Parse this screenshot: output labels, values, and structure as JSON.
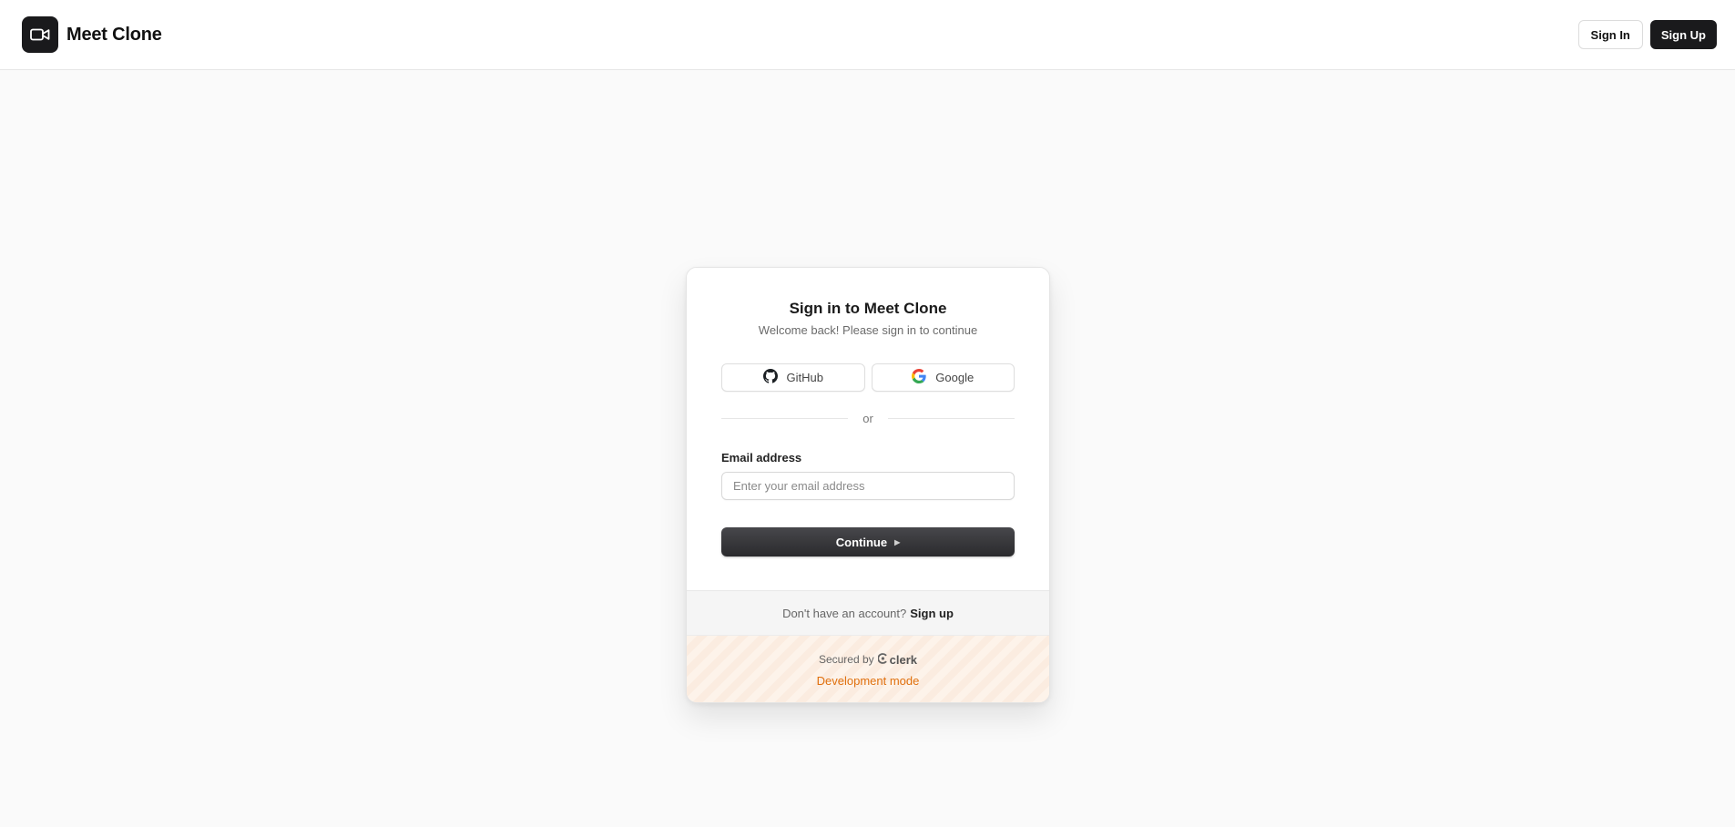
{
  "header": {
    "brand_icon": "video-camera-icon",
    "brand_name": "Meet Clone",
    "sign_in_label": "Sign In",
    "sign_up_label": "Sign Up"
  },
  "signin_card": {
    "title": "Sign in to Meet Clone",
    "subtitle": "Welcome back! Please sign in to continue",
    "social": [
      {
        "label": "GitHub",
        "icon": "github-icon"
      },
      {
        "label": "Google",
        "icon": "google-icon"
      }
    ],
    "divider_text": "or",
    "email": {
      "label": "Email address",
      "value": "",
      "placeholder": "Enter your email address"
    },
    "continue_label": "Continue",
    "no_account_text": "Don't have an account?",
    "signup_link": "Sign up",
    "secured_by": "Secured by",
    "clerk_name": "clerk",
    "dev_mode": "Development mode"
  },
  "colors": {
    "page_background": "#fafafa",
    "primary_dark": "#1a1a1c",
    "dev_mode_orange": "#e0700d"
  }
}
